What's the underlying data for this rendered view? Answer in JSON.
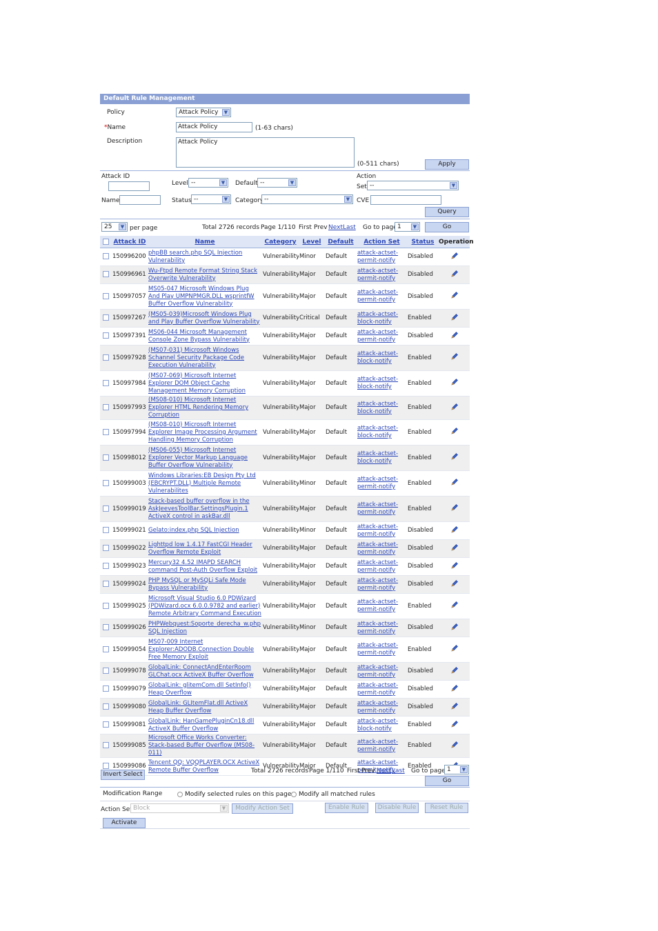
{
  "panel": {
    "title": "Default Rule Management"
  },
  "form": {
    "policy_label": "Policy",
    "policy_value": "Attack Policy",
    "name_required": "*",
    "name_label": "Name",
    "name_value": "Attack Policy",
    "name_hint": "(1-63   chars)",
    "description_label": "Description",
    "description_value": "Attack Policy",
    "description_hint": "(0-511   chars)",
    "apply_label": "Apply"
  },
  "filter": {
    "attack_id_label": "Attack ID",
    "level_label": "Level",
    "level_value": "--",
    "default_label": "Default",
    "default_value": "--",
    "action_label": "Action",
    "set_label": "Set",
    "set_value": "--",
    "name_label": "Name",
    "status_label": "Status",
    "status_value": "--",
    "category_label": "Category",
    "category_value": "--",
    "cve_label": "CVE",
    "query_label": "Query"
  },
  "pager": {
    "per_page_value": "25",
    "per_page_label": "per page",
    "total": "Total 2726 records",
    "page": "Page 1/110",
    "first": "First",
    "prev": "Prev",
    "next": "Next",
    "last": "Last",
    "goto_label": "Go to page",
    "goto_value": "1",
    "go_label": "Go"
  },
  "table": {
    "headers": [
      "Attack ID",
      "Name",
      "Category",
      "Level",
      "Default",
      "Action Set",
      "Status",
      "Operation"
    ],
    "rows": [
      {
        "id": "150996200",
        "name": "phpBB search.php SQL Injection Vulnerability",
        "cat": "Vulnerability",
        "level": "Minor",
        "def": "Default",
        "action": "attack-actset-permit-notify",
        "status": "Disabled"
      },
      {
        "id": "150996961",
        "name": "Wu-Ftpd Remote Format String Stack Overwrite Vulnerability",
        "cat": "Vulnerability",
        "level": "Major",
        "def": "Default",
        "action": "attack-actset-permit-notify",
        "status": "Disabled"
      },
      {
        "id": "150997057",
        "name": "MS05-047 Microsoft Windows Plug And Play UMPNPMGR.DLL wsprintfW Buffer Overflow Vulnerability",
        "cat": "Vulnerability",
        "level": "Major",
        "def": "Default",
        "action": "attack-actset-permit-notify",
        "status": "Disabled"
      },
      {
        "id": "150997267",
        "name": "(MS05-039)Microsoft Windows Plug and Play Buffer Overflow Vulnerability",
        "cat": "Vulnerability",
        "level": "Critical",
        "def": "Default",
        "action": "attack-actset-block-notify",
        "status": "Enabled"
      },
      {
        "id": "150997391",
        "name": "MS06-044 Microsoft Management Console Zone Bypass Vulnerability",
        "cat": "Vulnerability",
        "level": "Major",
        "def": "Default",
        "action": "attack-actset-permit-notify",
        "status": "Disabled"
      },
      {
        "id": "150997928",
        "name": "(MS07-031) Microsoft Windows Schannel Security Package Code Execution Vulnerability",
        "cat": "Vulnerability",
        "level": "Major",
        "def": "Default",
        "action": "attack-actset-block-notify",
        "status": "Enabled"
      },
      {
        "id": "150997984",
        "name": "(MS07-069) Microsoft Internet Explorer DOM Object Cache Management Memory Corruption",
        "cat": "Vulnerability",
        "level": "Major",
        "def": "Default",
        "action": "attack-actset-block-notify",
        "status": "Enabled"
      },
      {
        "id": "150997993",
        "name": "(MS08-010) Microsoft Internet Explorer HTML Rendering Memory Corruption",
        "cat": "Vulnerability",
        "level": "Major",
        "def": "Default",
        "action": "attack-actset-block-notify",
        "status": "Enabled"
      },
      {
        "id": "150997994",
        "name": "(MS08-010) Microsoft Internet Explorer Image Processing Argument Handling Memory Corruption",
        "cat": "Vulnerability",
        "level": "Major",
        "def": "Default",
        "action": "attack-actset-block-notify",
        "status": "Enabled"
      },
      {
        "id": "150998012",
        "name": "(MS06-055) Microsoft Internet Explorer Vector Markup Language Buffer Overflow Vulnerability",
        "cat": "Vulnerability",
        "level": "Major",
        "def": "Default",
        "action": "attack-actset-block-notify",
        "status": "Enabled"
      },
      {
        "id": "150999003",
        "name": "Windows Libraries:EB Design Pty Ltd (EBCRYPT.DLL) Multiple Remote Vulnerabilites",
        "cat": "Vulnerability",
        "level": "Minor",
        "def": "Default",
        "action": "attack-actset-permit-notify",
        "status": "Enabled"
      },
      {
        "id": "150999019",
        "name": "Stack-based buffer overflow in the AskJeevesToolBar.SettingsPlugin.1 ActiveX control in askBar.dll",
        "cat": "Vulnerability",
        "level": "Major",
        "def": "Default",
        "action": "attack-actset-permit-notify",
        "status": "Enabled"
      },
      {
        "id": "150999021",
        "name": "Gelato:index.php SQL Injection",
        "cat": "Vulnerability",
        "level": "Minor",
        "def": "Default",
        "action": "attack-actset-permit-notify",
        "status": "Disabled"
      },
      {
        "id": "150999022",
        "name": "Lighttpd low 1.4.17 FastCGI Header Overflow Remote Exploit",
        "cat": "Vulnerability",
        "level": "Major",
        "def": "Default",
        "action": "attack-actset-permit-notify",
        "status": "Disabled"
      },
      {
        "id": "150999023",
        "name": "Mercury32 4.52 IMAPD SEARCH command Post-Auth Overflow Exploit",
        "cat": "Vulnerability",
        "level": "Major",
        "def": "Default",
        "action": "attack-actset-permit-notify",
        "status": "Disabled"
      },
      {
        "id": "150999024",
        "name": "PHP MySQL or MySQLi Safe Mode Bypass Vulnerability",
        "cat": "Vulnerability",
        "level": "Major",
        "def": "Default",
        "action": "attack-actset-permit-notify",
        "status": "Disabled"
      },
      {
        "id": "150999025",
        "name": "Microsoft Visual Studio 6.0 PDWizard (PDWizard.ocx 6.0.0.9782 and earlier) Remote Arbitrary Command Execution",
        "cat": "Vulnerability",
        "level": "Major",
        "def": "Default",
        "action": "attack-actset-permit-notify",
        "status": "Enabled"
      },
      {
        "id": "150999026",
        "name": "PHPWebquest:Soporte_derecha_w.php SQL Injection",
        "cat": "Vulnerability",
        "level": "Minor",
        "def": "Default",
        "action": "attack-actset-permit-notify",
        "status": "Disabled"
      },
      {
        "id": "150999054",
        "name": "MS07-009 Internet Explorer:ADODB.Connection Double Free Memory Exploit",
        "cat": "Vulnerability",
        "level": "Major",
        "def": "Default",
        "action": "attack-actset-permit-notify",
        "status": "Enabled"
      },
      {
        "id": "150999078",
        "name": "GlobalLink: ConnectAndEnterRoom GLChat.ocx ActiveX Buffer Overflow",
        "cat": "Vulnerability",
        "level": "Major",
        "def": "Default",
        "action": "attack-actset-permit-notify",
        "status": "Disabled"
      },
      {
        "id": "150999079",
        "name": "GlobalLink: glitemCom.dll SetInfo() Heap Overflow",
        "cat": "Vulnerability",
        "level": "Major",
        "def": "Default",
        "action": "attack-actset-permit-notify",
        "status": "Disabled"
      },
      {
        "id": "150999080",
        "name": "GlobalLink: GLItemFlat.dll ActiveX Heap Buffer Overflow",
        "cat": "Vulnerability",
        "level": "Major",
        "def": "Default",
        "action": "attack-actset-permit-notify",
        "status": "Disabled"
      },
      {
        "id": "150999081",
        "name": "GlobalLink: HanGamePluginCn18.dll ActiveX Buffer Overflow",
        "cat": "Vulnerability",
        "level": "Major",
        "def": "Default",
        "action": "attack-actset-block-notify",
        "status": "Enabled"
      },
      {
        "id": "150999085",
        "name": "Microsoft Office Works Converter: Stack-based Buffer Overflow (MS08-011)",
        "cat": "Vulnerability",
        "level": "Major",
        "def": "Default",
        "action": "attack-actset-permit-notify",
        "status": "Enabled"
      },
      {
        "id": "150999086",
        "name": "Tencent QQ: VQQPLAYER.OCX ActiveX Remote Buffer Overflow",
        "cat": "Vulnerability",
        "level": "Major",
        "def": "Default",
        "action": "attack-actset-permit-notify",
        "status": "Enabled"
      }
    ]
  },
  "bottom": {
    "invert_label": "Invert Select",
    "total": "Total 2726 records",
    "page": "Page 1/110",
    "first": "First",
    "prev": "Prev",
    "next": "Next",
    "last": "Last",
    "goto_label": "Go to page",
    "goto_value": "1",
    "go_label": "Go",
    "range_label": "Modification Range",
    "range_opt1": "Modify selected rules on this page",
    "range_opt2": "Modify all matched rules",
    "action_set_label": "Action Set",
    "action_set_value": "Block",
    "modify_action_label": "Modify Action Set",
    "enable_label": "Enable Rule",
    "disable_label": "Disable Rule",
    "reset_label": "Reset Rule",
    "activate_label": "Activate"
  }
}
